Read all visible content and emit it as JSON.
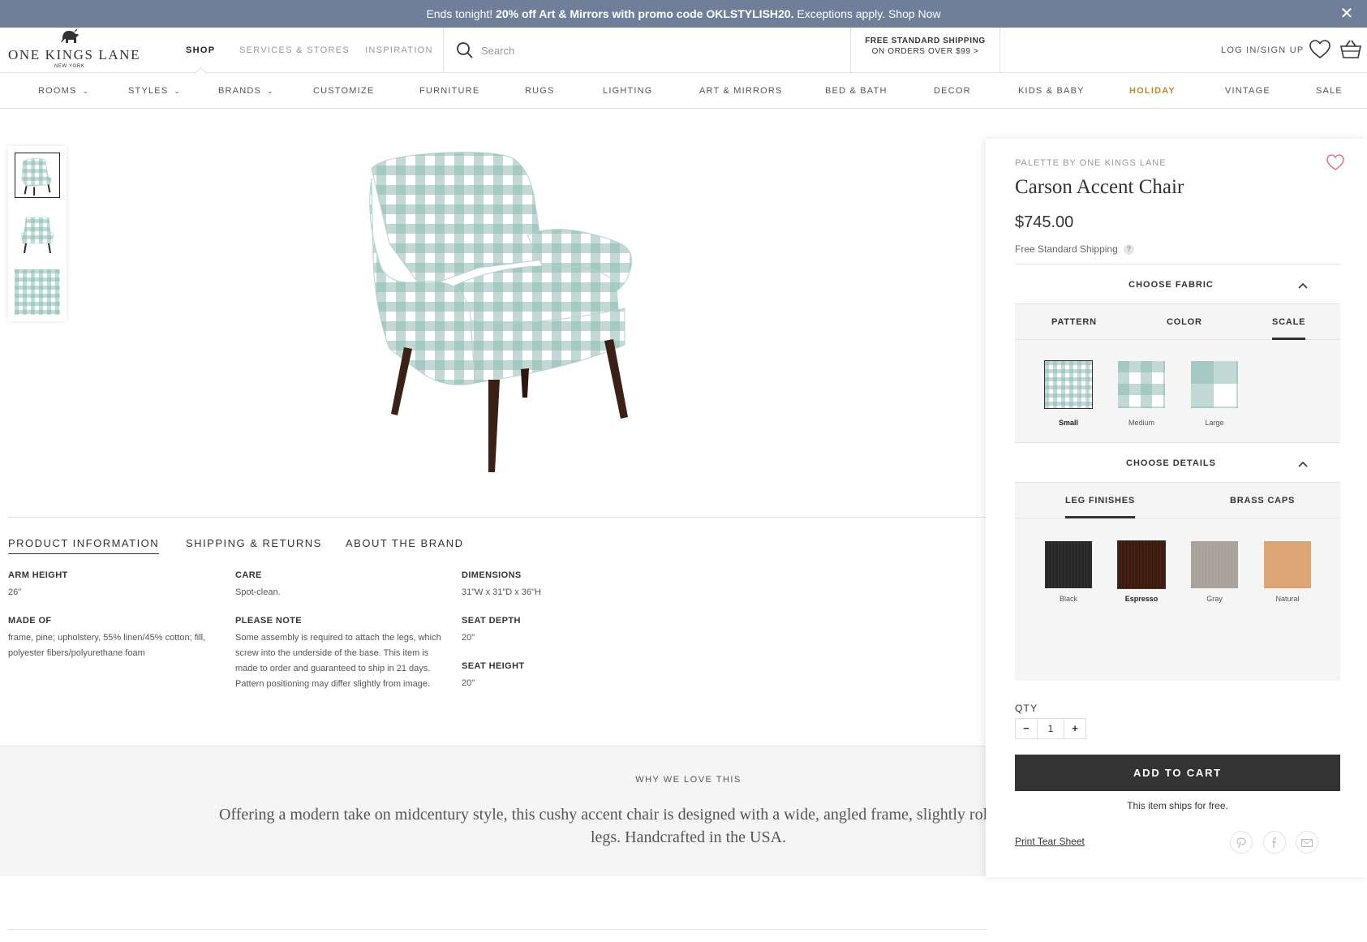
{
  "promo": {
    "lead": "Ends tonight! ",
    "bold": "20% off Art & Mirrors with promo code OKLSTYLISH20.",
    "tail": " Exceptions apply. Shop Now",
    "close": "✕"
  },
  "header": {
    "logo_text": "ONE KINGS LANE",
    "logo_city": "NEW YORK",
    "nav": [
      "SHOP",
      "SERVICES & STORES",
      "INSPIRATION"
    ],
    "search_placeholder": "Search",
    "free_shipping_line1": "FREE STANDARD SHIPPING",
    "free_shipping_line2": "ON ORDERS OVER $99 >",
    "login": "LOG IN/SIGN UP"
  },
  "categories": [
    "ROOMS",
    "STYLES",
    "BRANDS",
    "CUSTOMIZE",
    "FURNITURE",
    "RUGS",
    "LIGHTING",
    "ART & MIRRORS",
    "BED & BATH",
    "DECOR",
    "KIDS & BABY",
    "HOLIDAY",
    "VINTAGE",
    "SALE"
  ],
  "product": {
    "brand": "PALETTE BY ONE KINGS LANE",
    "name": "Carson Accent Chair",
    "price": "$745.00",
    "shipping": "Free Standard Shipping",
    "help": "?"
  },
  "tabs": [
    "PRODUCT INFORMATION",
    "SHIPPING & RETURNS",
    "ABOUT THE BRAND"
  ],
  "specs": {
    "arm_height_label": "ARM HEIGHT",
    "arm_height": "26\"",
    "made_of_label": "MADE OF",
    "made_of_1": "frame, pine; upholstery, 55% linen/45% cotton; fill,",
    "made_of_2": "polyester fibers/polyurethane foam",
    "care_label": "CARE",
    "care": "Spot-clean.",
    "note_label": "PLEASE NOTE",
    "note_1": "Some assembly is required to attach the legs, which",
    "note_2": "screw into the underside of the base. This item is",
    "note_3": "made to order and guaranteed to ship in 21 days.",
    "note_4": "Pattern positioning may differ slightly from image.",
    "dims_label": "DIMENSIONS",
    "dims": "31\"W x 31\"D x 36\"H",
    "seat_depth_label": "SEAT DEPTH",
    "seat_depth": "20\"",
    "seat_height_label": "SEAT HEIGHT",
    "seat_height": "20\""
  },
  "why": {
    "heading": "WHY WE LOVE THIS",
    "line1": "Offering a modern take on midcentury style, this cushy accent chair is designed with a wide, angled frame, slightly rol",
    "line2": "legs. Handcrafted in the USA."
  },
  "fabric": {
    "title": "CHOOSE FABRIC",
    "subtabs": [
      "PATTERN",
      "COLOR",
      "SCALE"
    ],
    "active_subtab": "SCALE",
    "options": [
      "Small",
      "Medium",
      "Large"
    ],
    "selected": "Small",
    "color": "#8fbab3"
  },
  "details": {
    "title": "CHOOSE DETAILS",
    "subtabs": [
      "LEG FINISHES",
      "BRASS CAPS"
    ],
    "active_subtab": "LEG FINISHES",
    "options": [
      {
        "name": "Black",
        "color": "#262626"
      },
      {
        "name": "Espresso",
        "color": "#3d1a0d"
      },
      {
        "name": "Gray",
        "color": "#a9a29b"
      },
      {
        "name": "Natural",
        "color": "#dba472"
      }
    ],
    "selected": "Espresso"
  },
  "cart": {
    "qty_label": "QTY",
    "qty_value": "1",
    "minus": "−",
    "plus": "+",
    "add_to_cart": "ADD TO CART",
    "ships_free": "This item ships for free.",
    "tear_sheet": "Print Tear Sheet"
  },
  "social": [
    "pinterest-icon",
    "facebook-icon",
    "email-icon"
  ],
  "colors": {
    "banner": "#6f7f99",
    "holiday": "#b8893b",
    "gingham": "#8fbab3",
    "heart": "#e8727a"
  }
}
